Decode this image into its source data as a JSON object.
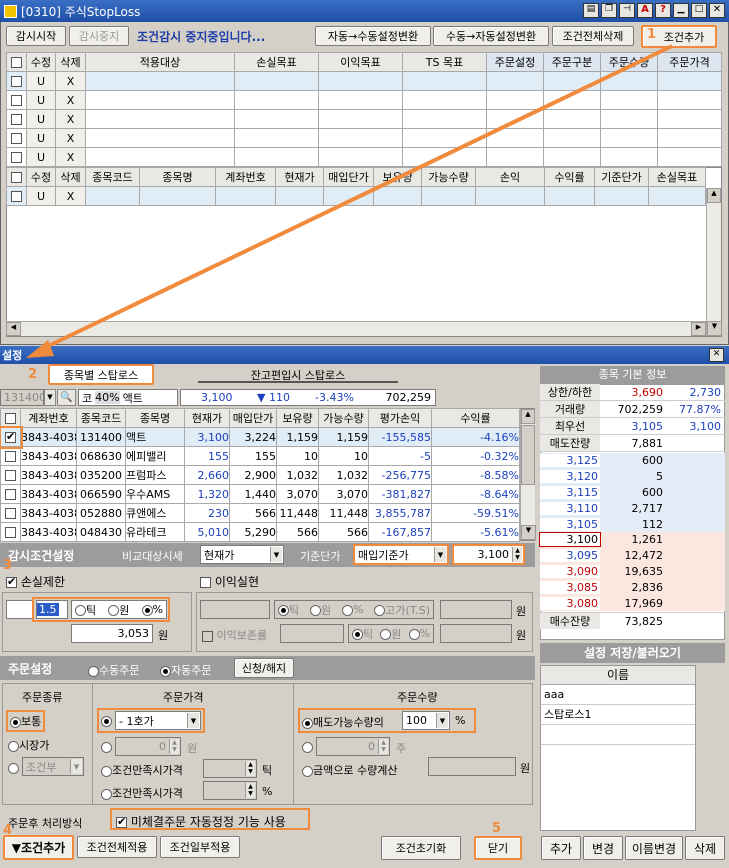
{
  "window": {
    "title": "[0310] 주식StopLoss"
  },
  "toolbar": {
    "start": "감시시작",
    "stop": "감시중지",
    "status": "조건감시 중지중입니다...",
    "auto_to_manual": "자동→수동설정변환",
    "manual_to_auto": "수동→자동설정변환",
    "delete_all": "조건전체삭제",
    "add_cond": "조건추가"
  },
  "cond_table": {
    "headers": [
      "수정",
      "삭제",
      "적용대상",
      "손실목표",
      "이익목표",
      "TS 목표",
      "주문설정",
      "주문구분",
      "주문수량",
      "주문가격"
    ],
    "edit": "U",
    "del": "X"
  },
  "pos_table": {
    "headers": [
      "수정",
      "삭제",
      "종목코드",
      "종목명",
      "계좌번호",
      "현재가",
      "매입단가",
      "보유량",
      "가능수량",
      "손익",
      "수익률",
      "기준단가",
      "손실목표"
    ]
  },
  "setup": {
    "title": "설정",
    "tab_stock": "종목별 스탑로스",
    "tab_balance": "잔고편입시 스탑로스"
  },
  "quote_bar": {
    "code": "131400",
    "ko": "코",
    "pct": "40%",
    "name": "액트",
    "price": "3,100",
    "change": "▼ 110",
    "rate": "-3.43%",
    "volume": "702,259"
  },
  "stock_table": {
    "headers": [
      "계좌번호",
      "종목코드",
      "종목명",
      "현재가",
      "매입단가",
      "보유량",
      "가능수량",
      "평가손익",
      "수익률"
    ],
    "rows": [
      {
        "acct": "3843-4038",
        "code": "131400",
        "name": "액트",
        "price": "3,100",
        "buy": "3,224",
        "hold": "1,159",
        "avail": "1,159",
        "pl": "-155,585",
        "rate": "-4.16%"
      },
      {
        "acct": "3843-4038",
        "code": "068630",
        "name": "에피밸리",
        "price": "155",
        "buy": "155",
        "hold": "10",
        "avail": "10",
        "pl": "-5",
        "rate": "-0.32%"
      },
      {
        "acct": "3843-4038",
        "code": "035200",
        "name": "프럼파스",
        "price": "2,660",
        "buy": "2,900",
        "hold": "1,032",
        "avail": "1,032",
        "pl": "-256,775",
        "rate": "-8.58%"
      },
      {
        "acct": "3843-4038",
        "code": "066590",
        "name": "우수AMS",
        "price": "1,320",
        "buy": "1,440",
        "hold": "3,070",
        "avail": "3,070",
        "pl": "-381,827",
        "rate": "-8.64%"
      },
      {
        "acct": "3843-4038",
        "code": "052880",
        "name": "큐앤에스",
        "price": "230",
        "buy": "566",
        "hold": "11,448",
        "avail": "11,448",
        "pl": "3,855,787",
        "rate": "-59.51%"
      },
      {
        "acct": "3843-4038",
        "code": "048430",
        "name": "유라테크",
        "price": "5,010",
        "buy": "5,290",
        "hold": "566",
        "avail": "566",
        "pl": "-167,857",
        "rate": "-5.61%"
      }
    ]
  },
  "watch": {
    "title": "감시조건설정",
    "compare_label": "비교대상시세",
    "compare_value": "현재가",
    "base_label": "기준단가",
    "base_value": "매입기준가",
    "base_price": "3,100"
  },
  "loss": {
    "label": "손실제한",
    "value": "1.5",
    "tick": "틱",
    "won": "원",
    "pct": "%",
    "amount": "3,053",
    "amount_unit": "원"
  },
  "profit": {
    "label": "이익실현",
    "tick": "틱",
    "won": "원",
    "pct": "%",
    "high": "고가(T.S)",
    "won_unit": "원",
    "preserve": "이익보존률"
  },
  "order": {
    "title": "주문설정",
    "manual": "수동주문",
    "auto": "자동주문",
    "apply": "신청/해지",
    "kind_title": "주문종류",
    "normal": "보통",
    "market": "시장가",
    "cond": "조건부",
    "price_title": "주문가격",
    "price_sel": "- 1호가",
    "won": "원",
    "cond_price1": "조건만족시가격",
    "tick": "틱",
    "cond_price2": "조건만족시가격",
    "pct": "%",
    "qty_title": "주문수량",
    "qty_label": "매도가능수량의",
    "qty_pct": "100",
    "qty_unit": "%",
    "ju": "주",
    "by_amount": "금액으로 수량계산",
    "won2": "원",
    "after_label": "주문후 처리방식",
    "after_check": "미체결주문 자동정정 기능 사용"
  },
  "bottom": {
    "add": "▼조건추가",
    "apply_all": "조건전체적용",
    "apply_part": "조건일부적용",
    "reset": "조건초기화",
    "close": "닫기"
  },
  "info": {
    "title": "종목 기본 정보",
    "upper_lower": "상한/하한",
    "upper": "3,690",
    "lower": "2,730",
    "volume_label": "거래량",
    "volume": "702,259",
    "volume_pct": "77.87%",
    "best_label": "최우선",
    "best1": "3,105",
    "best2": "3,100",
    "ask_total_label": "매도잔량",
    "ask_total": "7,881",
    "asks": [
      {
        "p": "3,125",
        "q": "600"
      },
      {
        "p": "3,120",
        "q": "5"
      },
      {
        "p": "3,115",
        "q": "600"
      },
      {
        "p": "3,110",
        "q": "2,717"
      },
      {
        "p": "3,105",
        "q": "112"
      }
    ],
    "bids": [
      {
        "p": "3,100",
        "q": "1,261"
      },
      {
        "p": "3,095",
        "q": "12,472"
      },
      {
        "p": "3,090",
        "q": "19,635"
      },
      {
        "p": "3,085",
        "q": "2,836"
      },
      {
        "p": "3,080",
        "q": "17,969"
      }
    ],
    "bid_total_label": "매수잔량",
    "bid_total": "73,825"
  },
  "saveload": {
    "title": "설정 저장/불러오기",
    "name_header": "이름",
    "items": [
      "aaa",
      "스탑로스1"
    ],
    "add": "추가",
    "change": "변경",
    "rename": "이름변경",
    "delete": "삭제"
  },
  "steps": [
    "1",
    "2",
    "3",
    "4",
    "5"
  ]
}
